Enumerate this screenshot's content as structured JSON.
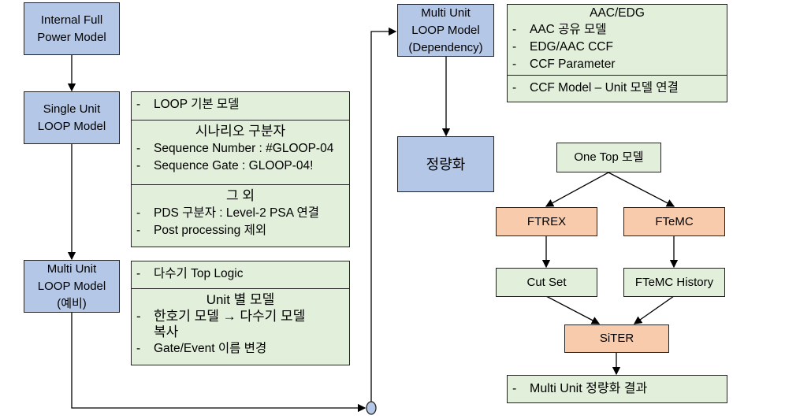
{
  "colors": {
    "model_box": "#b4c7e7",
    "note_box": "#e2efda",
    "tool_box": "#f8cbad",
    "connector": "#b4c7e7"
  },
  "left": {
    "internal": [
      "Internal Full",
      "Power Model"
    ],
    "single": [
      "Single Unit",
      "LOOP Model"
    ],
    "multi_pre": [
      "Multi Unit",
      "LOOP Model",
      "(예비)"
    ]
  },
  "panel1": {
    "s1": {
      "items": [
        "LOOP 기본 모델"
      ]
    },
    "s2": {
      "title": "시나리오 구분자",
      "items": [
        "Sequence Number : #GLOOP-04",
        "Sequence Gate : GLOOP-04!"
      ]
    },
    "s3": {
      "title": "그 외",
      "items": [
        "PDS 구분자 : Level-2 PSA 연결",
        "Post processing 제외"
      ]
    }
  },
  "panel2": {
    "s1": {
      "items": [
        "다수기 Top Logic"
      ]
    },
    "s2": {
      "title": "Unit 별 모델",
      "items": [
        "한호기 모델 → 다수기 모델 복사",
        "Gate/Event 이름 변경"
      ]
    }
  },
  "right": {
    "multi_dep": [
      "Multi Unit",
      "LOOP Model",
      "(Dependency)"
    ],
    "quant": "정량화",
    "aac": {
      "title": "AAC/EDG",
      "items": [
        "AAC 공유 모델",
        "EDG/AAC CCF",
        "CCF Parameter"
      ],
      "items2": [
        "CCF Model – Unit 모델 연결"
      ]
    },
    "one_top": "One Top 모델",
    "ftrex": "FTREX",
    "ftemc": "FTeMC",
    "cutset": "Cut Set",
    "ftemc_hist": "FTeMC History",
    "siter": "SiTER",
    "result": "Multi Unit 정량화 결과"
  }
}
